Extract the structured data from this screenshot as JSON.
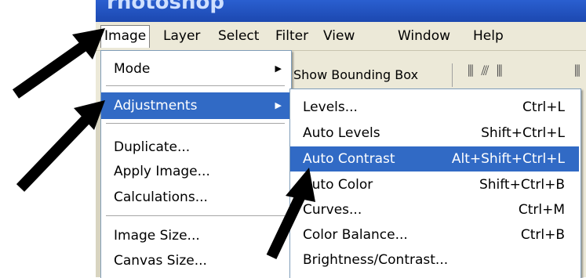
{
  "app": {
    "title_fragment": "rhotoshop"
  },
  "menubar": {
    "items": [
      "Image",
      "Layer",
      "Select",
      "Filter",
      "View",
      "Window",
      "Help"
    ]
  },
  "toolbar": {
    "label": "Show Bounding Box"
  },
  "image_menu": {
    "items": [
      {
        "label": "Mode"
      },
      {
        "label": "Adjustments"
      },
      {
        "label": "Duplicate..."
      },
      {
        "label": "Apply Image..."
      },
      {
        "label": "Calculations..."
      },
      {
        "label": "Image Size..."
      },
      {
        "label": "Canvas Size..."
      }
    ]
  },
  "adjustments_menu": {
    "items": [
      {
        "label": "Levels...",
        "shortcut": "Ctrl+L"
      },
      {
        "label": "Auto Levels",
        "shortcut": "Shift+Ctrl+L"
      },
      {
        "label": "Auto Contrast",
        "shortcut": "Alt+Shift+Ctrl+L"
      },
      {
        "label": "Auto Color",
        "shortcut": "Shift+Ctrl+B"
      },
      {
        "label": "Curves...",
        "shortcut": "Ctrl+M"
      },
      {
        "label": "Color Balance...",
        "shortcut": "Ctrl+B"
      },
      {
        "label": "Brightness/Contrast..."
      }
    ]
  },
  "colors": {
    "highlight": "#316ac5",
    "menu_bg": "#ffffff",
    "chrome": "#ece9d8",
    "titlebar": "#1c48b0"
  }
}
